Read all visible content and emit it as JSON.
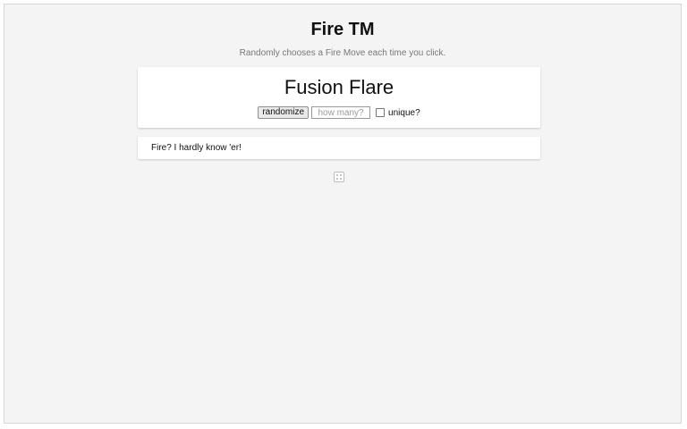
{
  "header": {
    "title": "Fire TM",
    "subtitle": "Randomly chooses a Fire Move each time you click."
  },
  "result": {
    "move": "Fusion Flare"
  },
  "controls": {
    "randomize_label": "randomize",
    "count_placeholder": "how many?",
    "count_value": "",
    "unique_label": "unique?",
    "unique_checked": false
  },
  "info": {
    "text": "Fire? I hardly know 'er!"
  },
  "footer": {
    "icon": "dice-icon"
  }
}
